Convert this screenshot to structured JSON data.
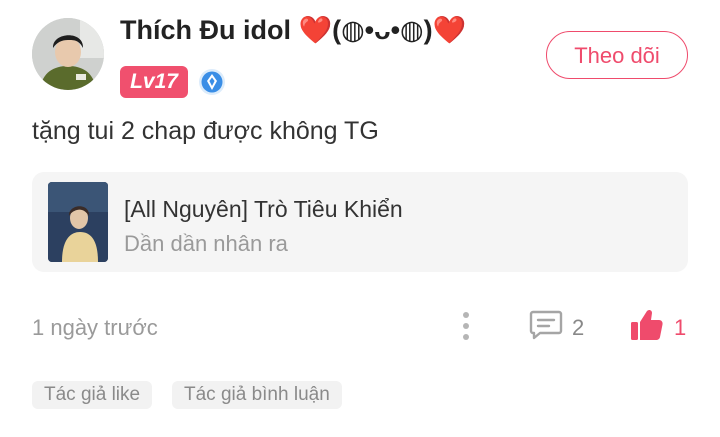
{
  "user": {
    "name": "Thích Đu idol ❤️(◍•ᴗ•◍)❤️",
    "level": "Lv17",
    "follow_label": "Theo dõi"
  },
  "comment": {
    "text": "tặng tui 2 chap được không TG"
  },
  "story": {
    "title": "[All Nguyên] Trò Tiêu Khiển",
    "subtitle": "Dần dần nhân ra"
  },
  "footer": {
    "time": "1 ngày trước",
    "reply_count": "2",
    "like_count": "1"
  },
  "tags": {
    "author_like": "Tác giả like",
    "author_comment": "Tác giả bình luận"
  },
  "icons": [
    "avatar",
    "verified-badge-icon",
    "more-vertical-icon",
    "comment-icon",
    "thumbs-up-icon"
  ],
  "colors": {
    "accent": "#ef4b6c",
    "level_badge": "#f0506e",
    "muted_text": "#9a9a9a",
    "card_bg": "#f5f5f5"
  }
}
